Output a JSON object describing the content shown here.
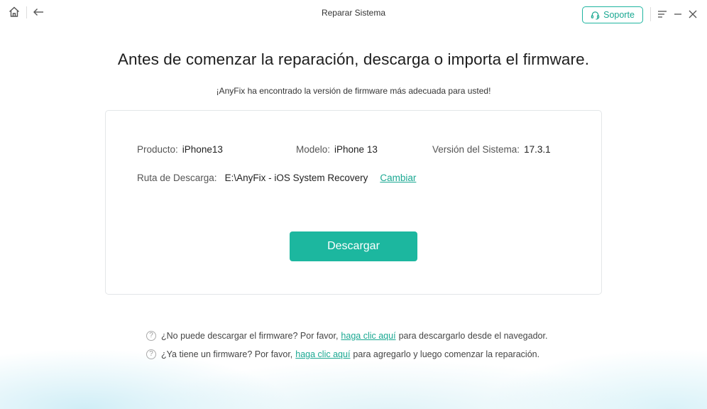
{
  "window": {
    "title": "Reparar Sistema"
  },
  "toolbar": {
    "home_icon": "home-icon",
    "back_icon": "arrow-left-icon",
    "support_label": "Soporte",
    "support_icon": "headset-icon",
    "menu_icon": "menu-icon",
    "minimize_icon": "minimize-icon",
    "close_icon": "close-icon"
  },
  "main": {
    "headline": "Antes de comenzar la reparación, descarga o importa el firmware.",
    "subline": "¡AnyFix ha encontrado la versión de firmware más adecuada para usted!"
  },
  "card": {
    "product_label": "Producto:",
    "product_value": "iPhone13",
    "model_label": "Modelo:",
    "model_value": "iPhone 13",
    "system_label": "Versión del Sistema:",
    "system_value": "17.3.1",
    "path_label": "Ruta de Descarga:",
    "path_value": "E:\\AnyFix - iOS System Recovery",
    "change_link": "Cambiar",
    "download_label": "Descargar"
  },
  "help": {
    "row1_prefix": "¿No puede descargar el firmware? Por favor,",
    "row1_link": "haga clic aquí",
    "row1_suffix": "para descargarlo desde el navegador.",
    "row2_prefix": "¿Ya tiene un firmware? Por favor,",
    "row2_link": "haga clic aquí",
    "row2_suffix": "para agregarlo y luego comenzar la reparación.",
    "help_icon": "question-circle-icon"
  },
  "colors": {
    "accent": "#1cb79f",
    "link": "#1aa892"
  }
}
